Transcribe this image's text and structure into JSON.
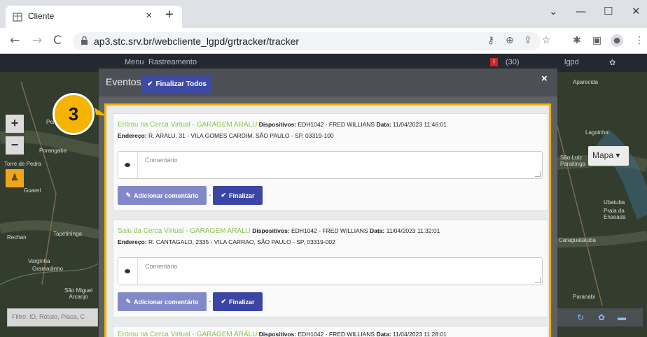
{
  "browser": {
    "tab_title": "Cliente",
    "tab_close": "×",
    "new_tab": "+",
    "window_controls": {
      "collapse": "⌄",
      "minimize": "—",
      "maximize": "☐",
      "close": "✕"
    },
    "nav": {
      "back": "←",
      "forward": "→",
      "reload": "C"
    },
    "url": "ap3.stc.srv.br/webcliente_lgpd/grtracker/tracker",
    "icons": [
      "key-icon",
      "zoom-icon",
      "share-icon",
      "star-icon",
      "extensions-icon",
      "sidepanel-icon",
      "profile-icon",
      "menu-icon"
    ]
  },
  "app_nav": {
    "menu": "Menu",
    "rastreamento": "Rastreamento",
    "count": "(30)",
    "user": "lgpd"
  },
  "map": {
    "zoom_in": "+",
    "zoom_out": "−",
    "mapa_button": "Mapa",
    "filter_placeholder": "Filtro: ID, Rótulo, Placa, C",
    "labels": [
      "Perdizes",
      "Porangaba",
      "Torre de Pedra",
      "Guareí",
      "Tapetininga",
      "Rechan",
      "Varginha",
      "Gramadinho",
      "São Miguel Arcanjo",
      "Lagoinha",
      "São Luiz Paraitinga",
      "Ubatuba",
      "Praia da Enseada",
      "Caraguatatuba",
      "Paranabi",
      "Aparecida"
    ]
  },
  "modal": {
    "title": "Eventos",
    "finalize_all": "Finalizar Todos",
    "close": "×",
    "step_badge": "3",
    "highlight_color": "#f4b400",
    "events": [
      {
        "title": "Entrou na Cerca Virtual - GARAGEM ARALU",
        "devices_label": "Dispositivos:",
        "devices": "EDH1042 - FRED WILLIANS",
        "date_label": "Data:",
        "date": "11/04/2023 11:46:01",
        "address_label": "Endereço:",
        "address": "R. ARALU, 31 - VILA GOMES CARDIM, SÃO PAULO - SP, 03319-100",
        "comment_placeholder": "Comentário",
        "add_comment": "Adicionar comentário",
        "separator": "-",
        "finalize": "Finalizar"
      },
      {
        "title": "Saiu da Cerca Virtual - GARAGEM ARALU",
        "devices_label": "Dispositivos:",
        "devices": "EDH1042 - FRED WILLIANS",
        "date_label": "Data:",
        "date": "11/04/2023 11:32:01",
        "address_label": "Endereço:",
        "address": "R. CANTAGALO, 2335 - VILA CARRAO, SÃO PAULO - SP, 03319-002",
        "comment_placeholder": "Comentário",
        "add_comment": "Adicionar comentário",
        "separator": "-",
        "finalize": "Finalizar"
      },
      {
        "title": "Entrou na Cerca Virtual - GARAGEM ARALU",
        "devices_label": "Dispositivos:",
        "devices": "EDH1042 - FRED WILLIANS",
        "date_label": "Data:",
        "date": "11/04/2023 11:28:01"
      }
    ]
  }
}
